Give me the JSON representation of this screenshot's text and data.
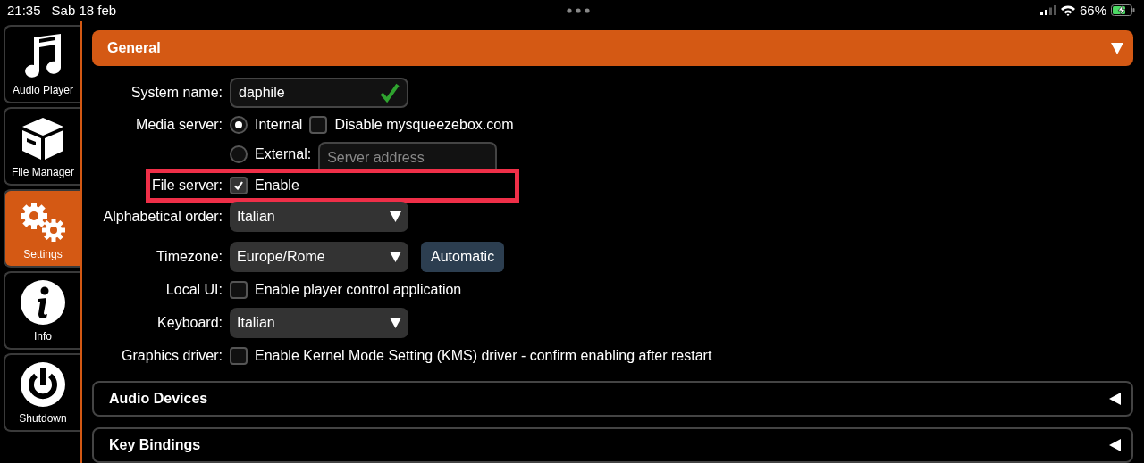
{
  "status_bar": {
    "time": "21:35",
    "date": "Sab 18 feb",
    "battery": "66%",
    "charging": true
  },
  "sidebar": {
    "items": [
      {
        "label": "Audio Player",
        "selected": false
      },
      {
        "label": "File Manager",
        "selected": false
      },
      {
        "label": "Settings",
        "selected": true
      },
      {
        "label": "Info",
        "selected": false
      },
      {
        "label": "Shutdown",
        "selected": false
      }
    ]
  },
  "sections": [
    {
      "title": "General",
      "expanded": true,
      "rows": [
        {
          "kind": "text",
          "label": "System name:",
          "value": "daphile",
          "valid": true
        },
        {
          "kind": "radio",
          "label": "Media server:",
          "option": "Internal",
          "selected": true,
          "checkbox": {
            "label": "Disable mysqueezebox.com",
            "checked": false
          }
        },
        {
          "kind": "radio",
          "option": "External:",
          "selected": false,
          "placeholder": "Server address"
        },
        {
          "kind": "checkbox",
          "label": "File server:",
          "option": "Enable",
          "checked": true,
          "highlighted": true
        },
        {
          "kind": "select",
          "label": "Alphabetical order:",
          "value": "Italian"
        },
        {
          "kind": "select",
          "label": "Timezone:",
          "value": "Europe/Rome",
          "button": "Automatic"
        },
        {
          "kind": "checkbox",
          "label": "Local UI:",
          "option": "Enable player control application",
          "checked": false
        },
        {
          "kind": "select",
          "label": "Keyboard:",
          "value": "Italian"
        },
        {
          "kind": "checkbox",
          "label": "Graphics driver:",
          "option": "Enable Kernel Mode Setting (KMS) driver - confirm enabling after restart",
          "checked": false
        }
      ]
    },
    {
      "title": "Audio Devices",
      "expanded": false
    },
    {
      "title": "Key Bindings",
      "expanded": false
    }
  ]
}
